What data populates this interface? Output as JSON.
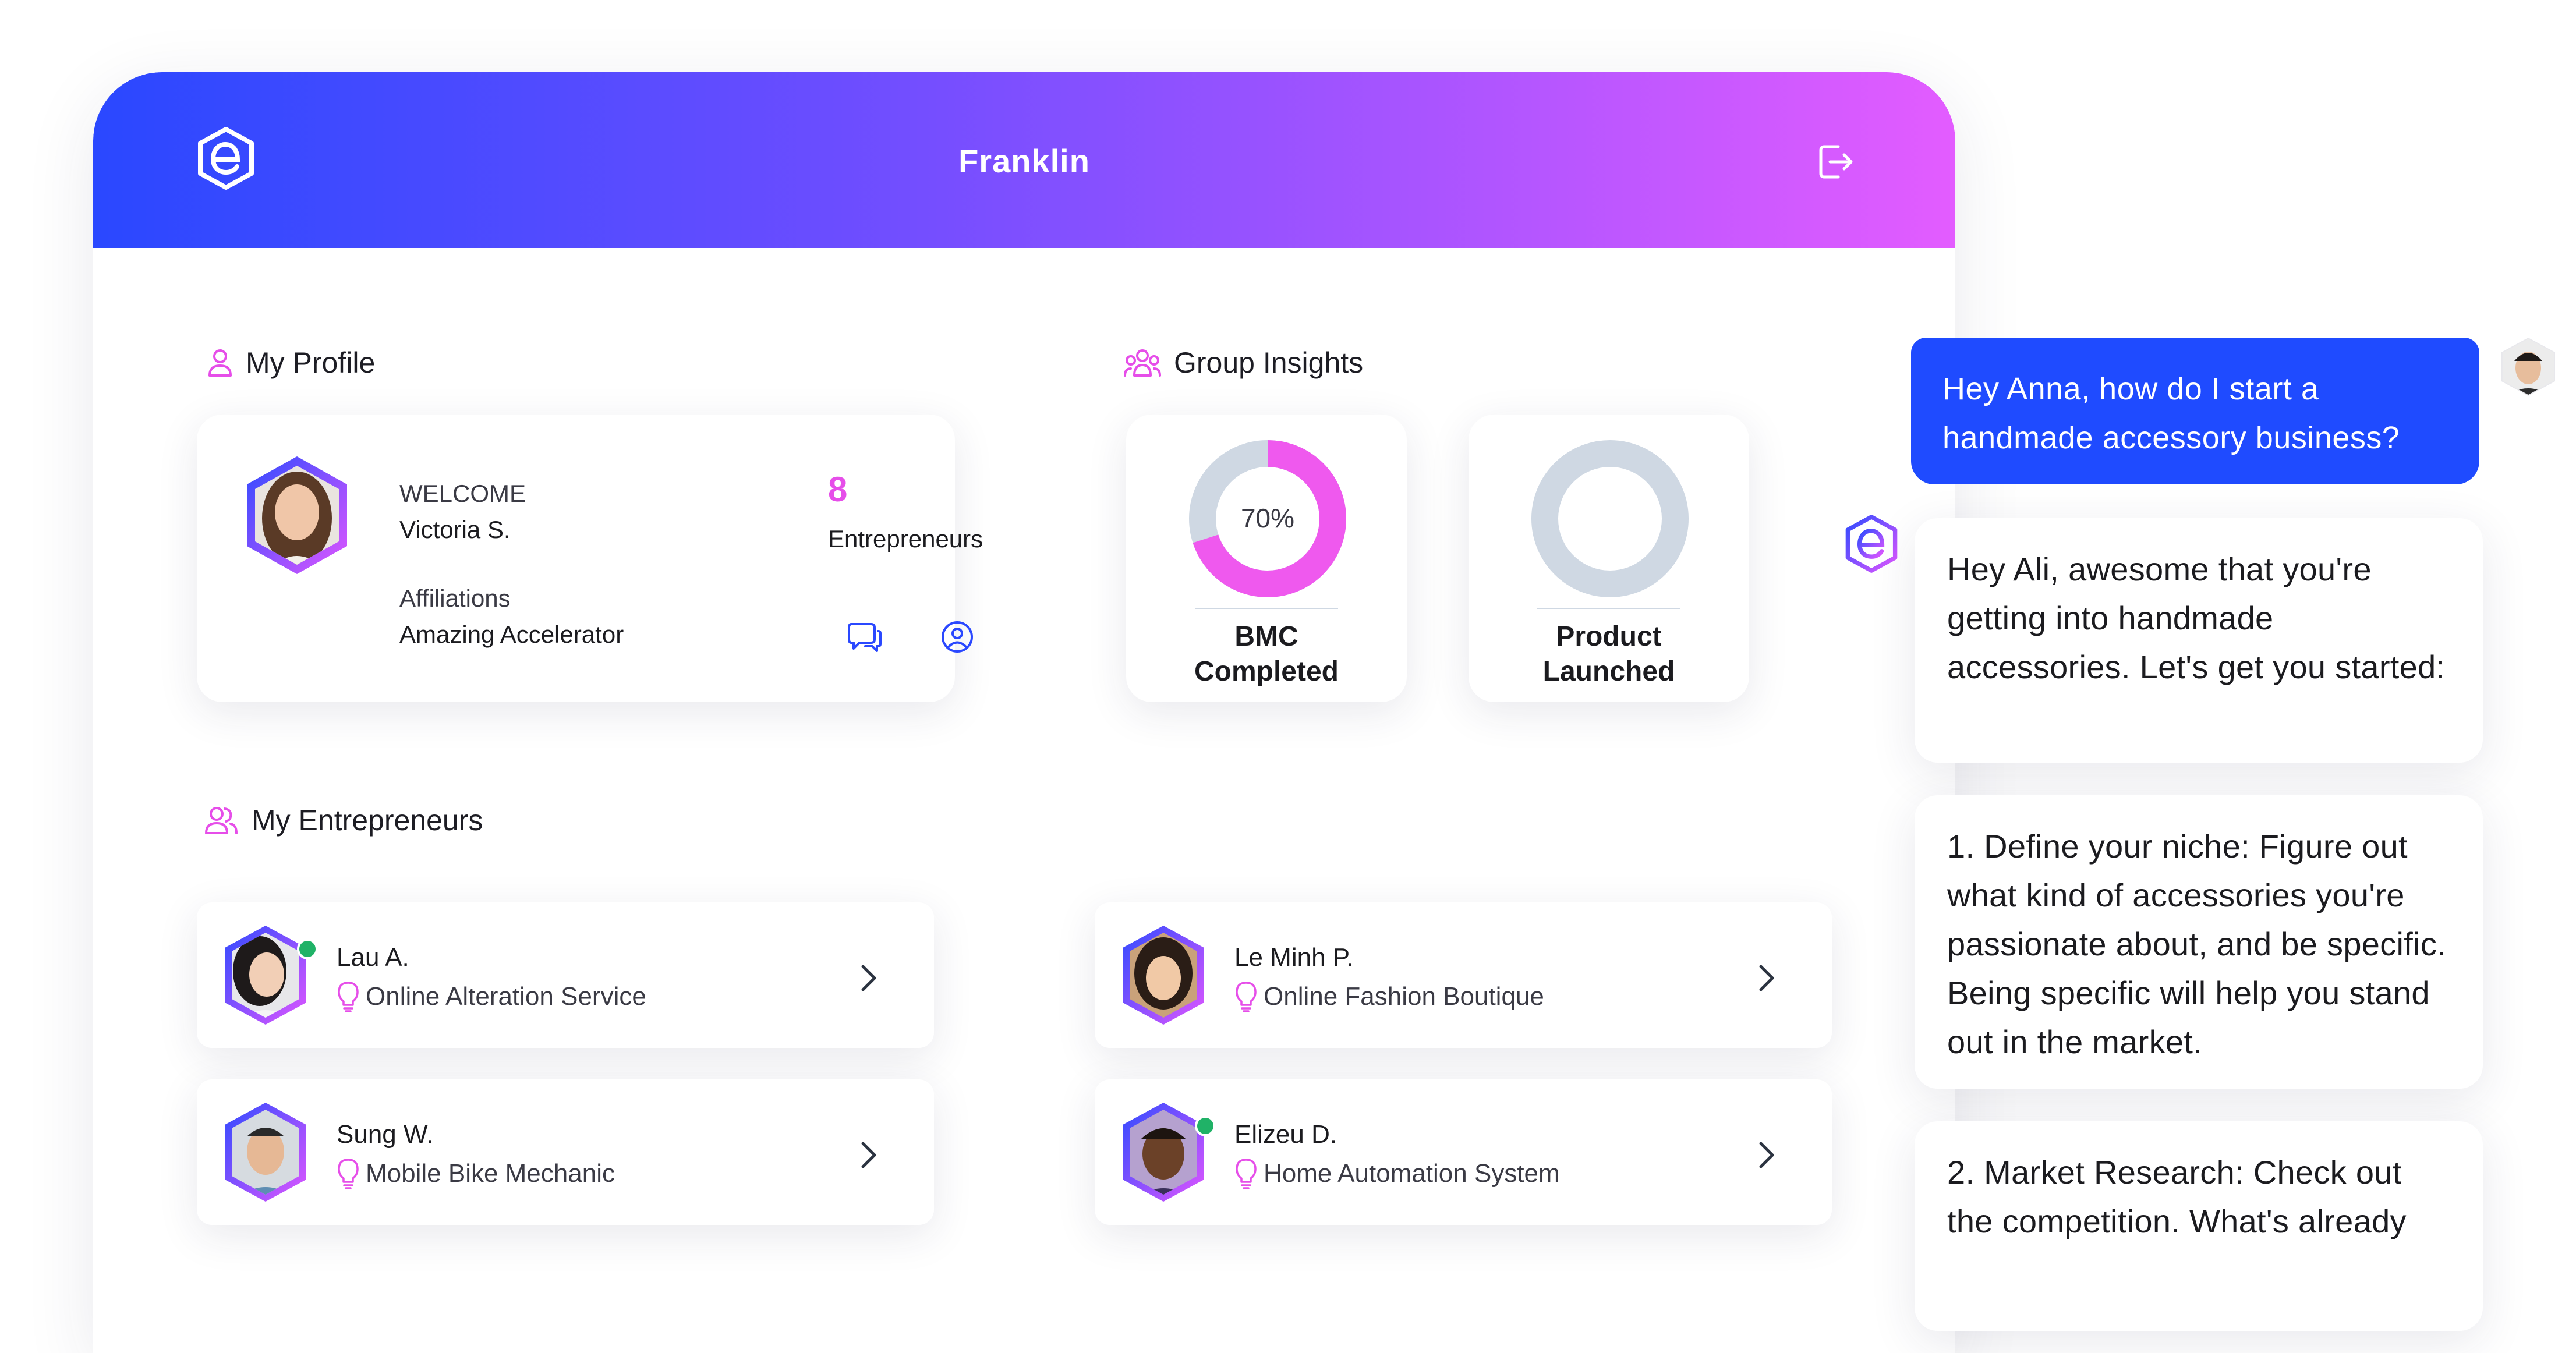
{
  "header": {
    "title": "Franklin"
  },
  "profile": {
    "section_title": "My Profile",
    "welcome_label": "WELCOME",
    "name": "Victoria S.",
    "affiliations_label": "Affiliations",
    "affiliation": "Amazing Accelerator",
    "entrepreneur_count": "8",
    "entrepreneur_label": "Entrepreneurs"
  },
  "insights": {
    "section_title": "Group Insights",
    "cards": [
      {
        "percent_text": "70%",
        "percent": 70,
        "line1": "BMC",
        "line2": "Completed"
      },
      {
        "percent_text": "",
        "percent": 0,
        "line1": "Product",
        "line2": "Launched"
      }
    ]
  },
  "entrepreneurs": {
    "section_title": "My Entrepreneurs",
    "items": [
      {
        "name": "Lau A.",
        "business": "Online Alteration Service",
        "online": true
      },
      {
        "name": "Le Minh P.",
        "business": "Online Fashion Boutique",
        "online": false
      },
      {
        "name": "Sung W.",
        "business": "Mobile Bike Mechanic",
        "online": false
      },
      {
        "name": "Elizeu D.",
        "business": "Home Automation System",
        "online": true
      }
    ]
  },
  "chat": {
    "user_message": "Hey Anna, how do I start a handmade accessory business?",
    "bot_messages": [
      "Hey Ali, awesome that you're getting into handmade accessories. Let's get you started:",
      "1. Define your niche: Figure out what kind of accessories you're passionate about, and be specific. Being specific will help you stand out in the market.",
      "2. Market Research: Check out the competition. What's already"
    ]
  },
  "colors": {
    "brand_blue": "#2a48ff",
    "brand_pink": "#e35cff",
    "accent_pink": "#e64ee9",
    "online_green": "#20b267",
    "donut_track": "#cfd8e3"
  }
}
